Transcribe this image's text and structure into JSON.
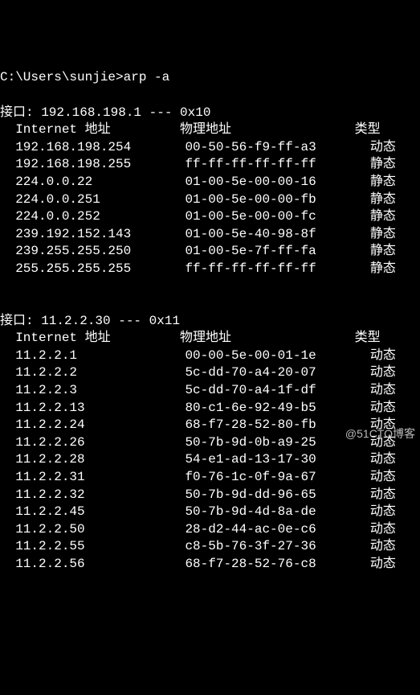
{
  "prompt": "C:\\Users\\sunjie>",
  "command": "arp -a",
  "blank": "",
  "interfaces": [
    {
      "header": "接口: 192.168.198.1 --- 0x10",
      "col_ip": "  Internet 地址",
      "col_mac": "物理地址",
      "col_type": "类型",
      "rows": [
        {
          "ip": "  192.168.198.254",
          "mac": "00-50-56-f9-ff-a3",
          "type": "动态"
        },
        {
          "ip": "  192.168.198.255",
          "mac": "ff-ff-ff-ff-ff-ff",
          "type": "静态"
        },
        {
          "ip": "  224.0.0.22",
          "mac": "01-00-5e-00-00-16",
          "type": "静态"
        },
        {
          "ip": "  224.0.0.251",
          "mac": "01-00-5e-00-00-fb",
          "type": "静态"
        },
        {
          "ip": "  224.0.0.252",
          "mac": "01-00-5e-00-00-fc",
          "type": "静态"
        },
        {
          "ip": "  239.192.152.143",
          "mac": "01-00-5e-40-98-8f",
          "type": "静态"
        },
        {
          "ip": "  239.255.255.250",
          "mac": "01-00-5e-7f-ff-fa",
          "type": "静态"
        },
        {
          "ip": "  255.255.255.255",
          "mac": "ff-ff-ff-ff-ff-ff",
          "type": "静态"
        }
      ]
    },
    {
      "header": "接口: 11.2.2.30 --- 0x11",
      "col_ip": "  Internet 地址",
      "col_mac": "物理地址",
      "col_type": "类型",
      "rows": [
        {
          "ip": "  11.2.2.1",
          "mac": "00-00-5e-00-01-1e",
          "type": "动态"
        },
        {
          "ip": "  11.2.2.2",
          "mac": "5c-dd-70-a4-20-07",
          "type": "动态"
        },
        {
          "ip": "  11.2.2.3",
          "mac": "5c-dd-70-a4-1f-df",
          "type": "动态"
        },
        {
          "ip": "  11.2.2.13",
          "mac": "80-c1-6e-92-49-b5",
          "type": "动态"
        },
        {
          "ip": "  11.2.2.24",
          "mac": "68-f7-28-52-80-fb",
          "type": "动态"
        },
        {
          "ip": "  11.2.2.26",
          "mac": "50-7b-9d-0b-a9-25",
          "type": "动态"
        },
        {
          "ip": "  11.2.2.28",
          "mac": "54-e1-ad-13-17-30",
          "type": "动态"
        },
        {
          "ip": "  11.2.2.31",
          "mac": "f0-76-1c-0f-9a-67",
          "type": "动态"
        },
        {
          "ip": "  11.2.2.32",
          "mac": "50-7b-9d-dd-96-65",
          "type": "动态"
        },
        {
          "ip": "  11.2.2.45",
          "mac": "50-7b-9d-4d-8a-de",
          "type": "动态"
        },
        {
          "ip": "  11.2.2.50",
          "mac": "28-d2-44-ac-0e-c6",
          "type": "动态"
        },
        {
          "ip": "  11.2.2.55",
          "mac": "c8-5b-76-3f-27-36",
          "type": "动态"
        },
        {
          "ip": "  11.2.2.56",
          "mac": "68-f7-28-52-76-c8",
          "type": "动态"
        }
      ]
    }
  ],
  "watermark": "@51CTO博客"
}
